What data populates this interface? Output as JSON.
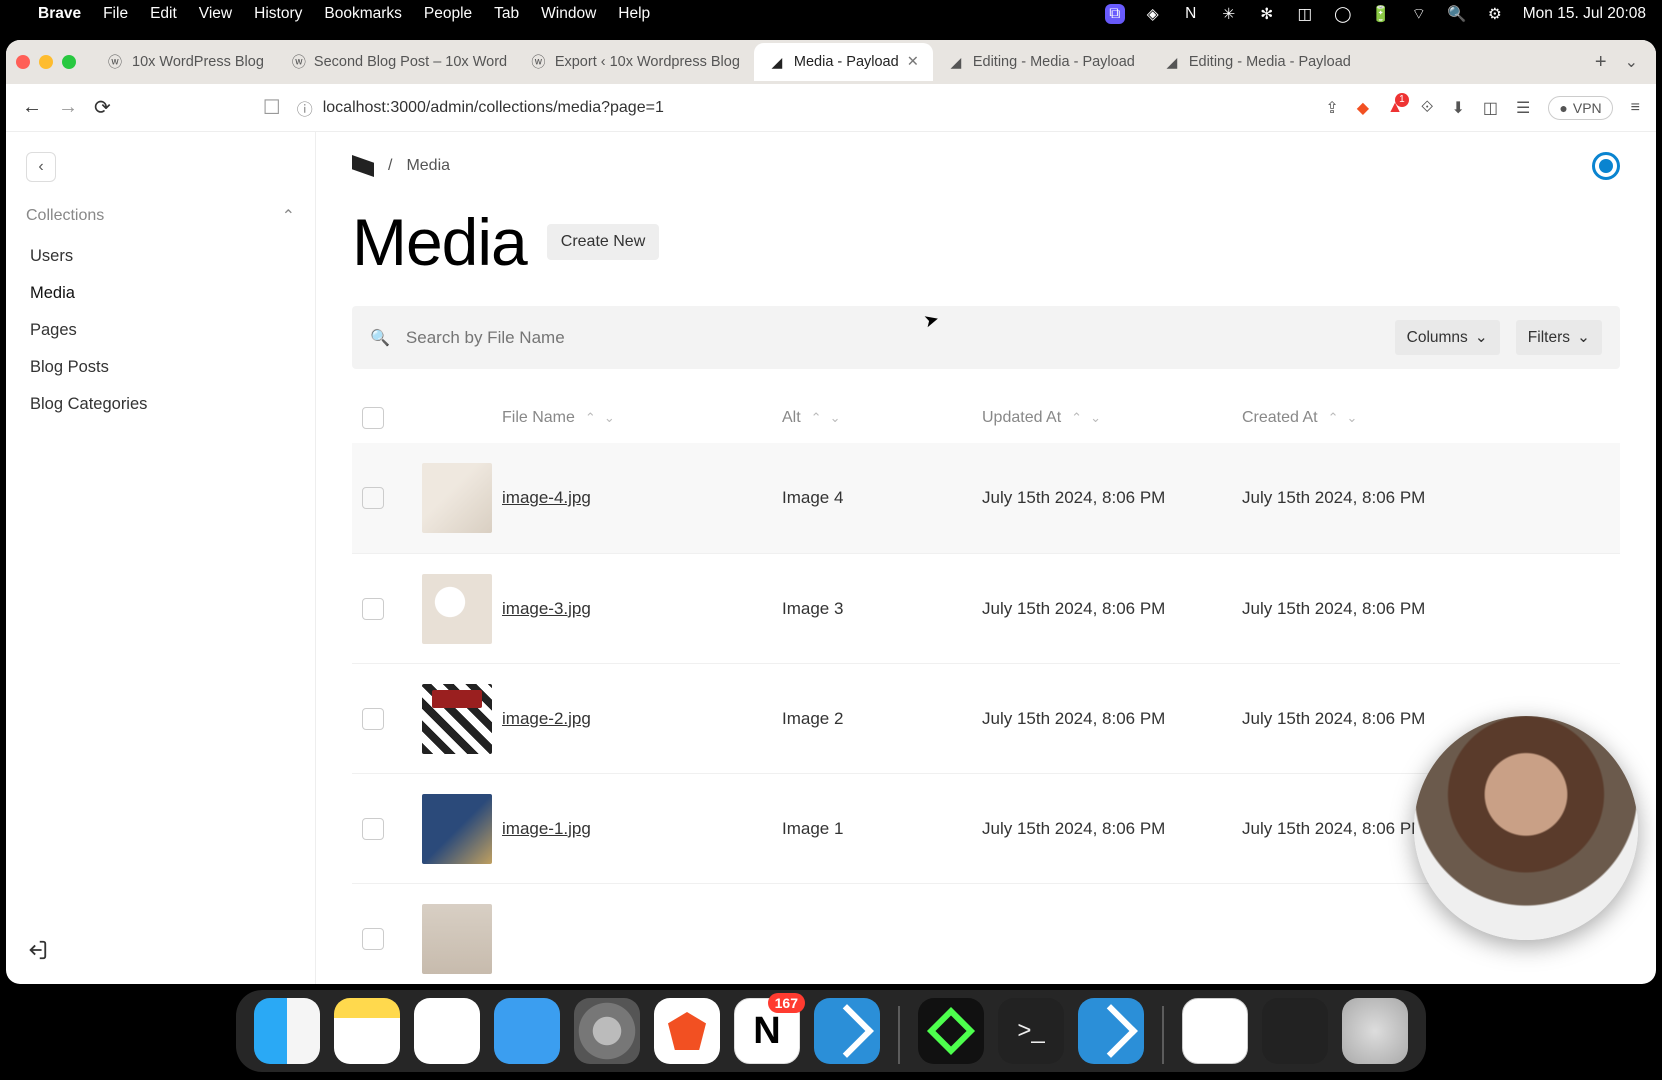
{
  "menubar": {
    "app": "Brave",
    "items": [
      "File",
      "Edit",
      "View",
      "History",
      "Bookmarks",
      "People",
      "Tab",
      "Window",
      "Help"
    ],
    "clock": "Mon 15. Jul  20:08"
  },
  "tabs": [
    {
      "label": "10x WordPress Blog",
      "favicon": "wp"
    },
    {
      "label": "Second Blog Post – 10x Word",
      "favicon": "wp"
    },
    {
      "label": "Export ‹ 10x Wordpress Blog",
      "favicon": "wp"
    },
    {
      "label": "Media - Payload",
      "favicon": "payload",
      "active": true
    },
    {
      "label": "Editing - Media - Payload",
      "favicon": "payload"
    },
    {
      "label": "Editing - Media - Payload",
      "favicon": "payload"
    }
  ],
  "url": "localhost:3000/admin/collections/media?page=1",
  "vpn_label": "VPN",
  "sidebar": {
    "group": "Collections",
    "items": [
      "Users",
      "Media",
      "Pages",
      "Blog Posts",
      "Blog Categories"
    ],
    "active": "Media"
  },
  "breadcrumb": {
    "sep": "/",
    "crumb": "Media"
  },
  "page": {
    "title": "Media",
    "create": "Create New"
  },
  "search": {
    "placeholder": "Search by File Name",
    "columns": "Columns",
    "filters": "Filters"
  },
  "columns": [
    "File Name",
    "Alt",
    "Updated At",
    "Created At"
  ],
  "rows": [
    {
      "file": "image-4.jpg",
      "alt": "Image 4",
      "updated": "July 15th 2024, 8:06 PM",
      "created": "July 15th 2024, 8:06 PM",
      "thumb": "t1"
    },
    {
      "file": "image-3.jpg",
      "alt": "Image 3",
      "updated": "July 15th 2024, 8:06 PM",
      "created": "July 15th 2024, 8:06 PM",
      "thumb": "t2"
    },
    {
      "file": "image-2.jpg",
      "alt": "Image 2",
      "updated": "July 15th 2024, 8:06 PM",
      "created": "July 15th 2024, 8:06 PM",
      "thumb": "t3"
    },
    {
      "file": "image-1.jpg",
      "alt": "Image 1",
      "updated": "July 15th 2024, 8:06 PM",
      "created": "July 15th 2024, 8:06 PM",
      "thumb": "t4"
    },
    {
      "file": "",
      "alt": "",
      "updated": "",
      "created": "",
      "thumb": "t5"
    }
  ],
  "notion_badge": "167"
}
